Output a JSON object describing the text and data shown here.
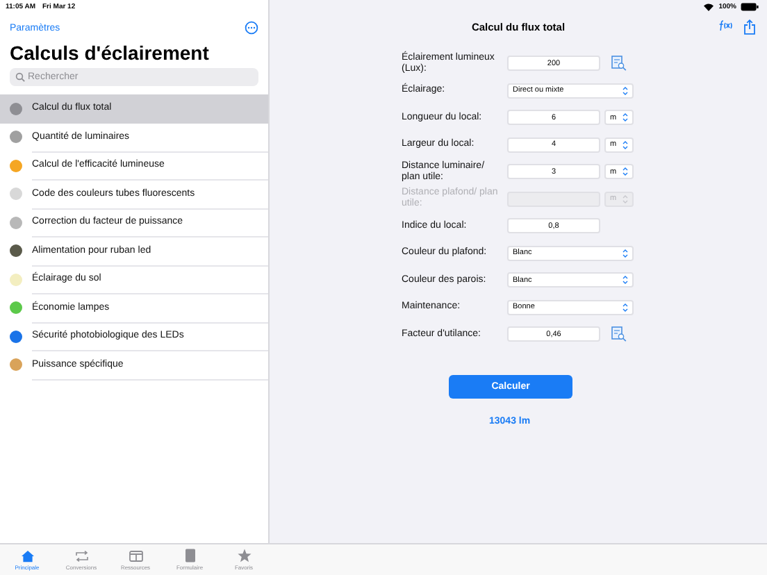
{
  "status_bar": {
    "time": "11:05 AM",
    "date": "Fri Mar 12",
    "battery": "100%"
  },
  "sidebar": {
    "back": "Paramètres",
    "title": "Calculs d'éclairement",
    "search": {
      "placeholder": "Rechercher"
    },
    "items": [
      {
        "label": "Calcul du flux total",
        "selected": true,
        "color": "#8e8e93"
      },
      {
        "label": "Quantité de luminaires",
        "selected": false,
        "color": "#a0a0a0"
      },
      {
        "label": "Calcul de l'efficacité lumineuse",
        "selected": false,
        "color": "#f5a623"
      },
      {
        "label": "Code des couleurs tubes fluorescents",
        "selected": false,
        "color": "#d8d8d8"
      },
      {
        "label": "Correction du facteur de puissance",
        "selected": false,
        "color": "#b8b8b8"
      },
      {
        "label": "Alimentation pour ruban led",
        "selected": false,
        "color": "#5a5a4a"
      },
      {
        "label": "Éclairage du sol",
        "selected": false,
        "color": "#f3eec0"
      },
      {
        "label": "Économie lampes",
        "selected": false,
        "color": "#5cc94a"
      },
      {
        "label": "Sécurité photobiologique des LEDs",
        "selected": false,
        "color": "#1a73e8"
      },
      {
        "label": "Puissance spécifique",
        "selected": false,
        "color": "#d9a35a"
      }
    ]
  },
  "detail": {
    "title": "Calcul du flux total",
    "fields": [
      {
        "kind": "input",
        "label": "Éclairement lumineux (Lux):",
        "value": "200",
        "lookup": true,
        "disabled": false
      },
      {
        "kind": "select",
        "label": "Éclairage:",
        "value": "Direct ou mixte",
        "disabled": false
      },
      {
        "kind": "unit",
        "label": "Longueur du local:",
        "value": "6",
        "unit": "m",
        "disabled": false
      },
      {
        "kind": "unit",
        "label": "Largeur du local:",
        "value": "4",
        "unit": "m",
        "disabled": false
      },
      {
        "kind": "unit",
        "label": "Distance luminaire/ plan utile:",
        "value": "3",
        "unit": "m",
        "disabled": false
      },
      {
        "kind": "unit",
        "label": "Distance plafond/ plan utile:",
        "unit": "m",
        "disabled": true
      },
      {
        "kind": "input",
        "label": "Indice du local:",
        "value": "0,8",
        "lookup": false,
        "disabled": false
      },
      {
        "kind": "select",
        "label": "Couleur du plafond:",
        "value": "Blanc",
        "disabled": false
      },
      {
        "kind": "select",
        "label": "Couleur des parois:",
        "value": "Blanc",
        "disabled": false
      },
      {
        "kind": "select",
        "label": "Maintenance:",
        "value": "Bonne",
        "disabled": false
      },
      {
        "kind": "input",
        "label": "Facteur d'utilance:",
        "value": "0,46",
        "lookup": true,
        "disabled": false
      }
    ],
    "button": "Calculer",
    "result": "13043 lm"
  },
  "tabs": [
    {
      "kind": "home",
      "label": "Principale",
      "selected": true
    },
    {
      "kind": "convert",
      "label": "Conversions",
      "selected": false
    },
    {
      "kind": "panel",
      "label": "Ressources",
      "selected": false
    },
    {
      "kind": "book",
      "label": "Formulaire",
      "selected": false
    },
    {
      "kind": "star",
      "label": "Favoris",
      "selected": false
    }
  ]
}
